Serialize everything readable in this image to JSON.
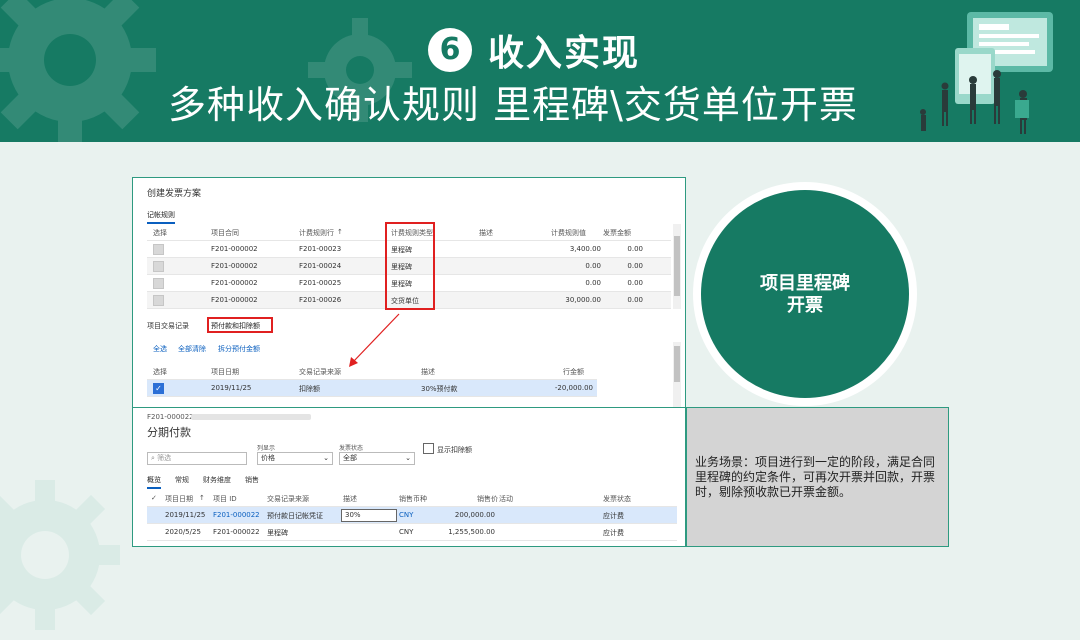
{
  "header": {
    "step_number": "6",
    "step_title": "收入实现",
    "subtitle": "多种收入确认规则   里程碑\\交货单位开票"
  },
  "billing_screen": {
    "title": "创建发票方案",
    "tab": "记帐规则",
    "columns": [
      "选择",
      "项目合同",
      "计费规则行",
      "计费规则类型",
      "描述",
      "计费规则值",
      "发票金额"
    ],
    "sort_indicator": "↑",
    "rows": [
      {
        "contract": "F201-000002",
        "rule_line": "F201-00023",
        "rule_type": "里程碑",
        "desc": "",
        "value": "3,400.00",
        "invoice": "0.00"
      },
      {
        "contract": "F201-000002",
        "rule_line": "F201-00024",
        "rule_type": "里程碑",
        "desc": "",
        "value": "0.00",
        "invoice": "0.00"
      },
      {
        "contract": "F201-000002",
        "rule_line": "F201-00025",
        "rule_type": "里程碑",
        "desc": "",
        "value": "0.00",
        "invoice": "0.00"
      },
      {
        "contract": "F201-000002",
        "rule_line": "F201-00026",
        "rule_type": "交货单位",
        "desc": "",
        "value": "30,000.00",
        "invoice": "0.00"
      }
    ],
    "transactions_label": "项目交易记录",
    "transactions_tab": "预付款和扣除额",
    "actions": [
      "全选",
      "全部清除",
      "拆分预付金额"
    ],
    "tx_columns": [
      "选择",
      "项目日期",
      "交易记录来源",
      "描述",
      "行金额"
    ],
    "tx_rows": [
      {
        "date": "2019/11/25",
        "source": "扣除额",
        "desc": "30%预付款",
        "amount": "-20,000.00",
        "checked": "✓"
      }
    ]
  },
  "installment_screen": {
    "record_id": "F201-000022",
    "title": "分期付款",
    "search_placeholder": "筛选",
    "display_label": "列显示",
    "display_value": "价格",
    "invoice_status_label": "发票状态",
    "invoice_status_value": "全部",
    "show_deductions": "显示扣除额",
    "tabs": [
      "概览",
      "常规",
      "财务维度",
      "销售"
    ],
    "columns": [
      "项目日期",
      "项目 ID",
      "交易记录来源",
      "描述",
      "销售币种",
      "销售价",
      "活动",
      "发票状态"
    ],
    "sort_indicator": "↑",
    "rows": [
      {
        "date": "2019/11/25",
        "project_id": "F201-000022",
        "source": "预付款日记帐凭证",
        "desc": "30%",
        "currency": "CNY",
        "price": "200,000.00",
        "activity": "",
        "status": "应计费"
      },
      {
        "date": "2020/5/25",
        "project_id": "F201-000022",
        "source": "里程碑",
        "desc": "",
        "currency": "CNY",
        "price": "1,255,500.00",
        "activity": "",
        "status": "应计费"
      }
    ]
  },
  "circle": {
    "line1": "项目里程碑",
    "line2": "开票"
  },
  "description": "业务场景：项目进行到一定的阶段，满足合同里程碑的约定条件，可再次开票并回款，开票时，剔除预收款已开票金额。",
  "colors": {
    "brand_green": "#167a63",
    "highlight_red": "#e02020",
    "link_blue": "#0a5fbf"
  }
}
